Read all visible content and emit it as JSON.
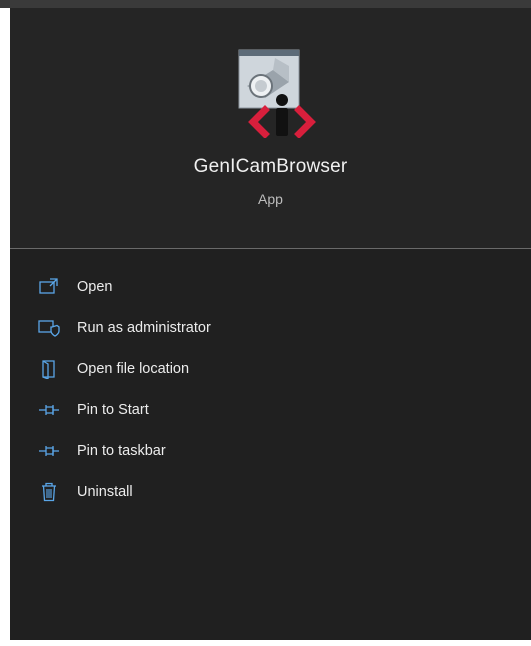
{
  "app": {
    "name": "GenICamBrowser",
    "kind": "App",
    "icon": "genicam-browser-icon"
  },
  "colors": {
    "panel_bg": "#202020",
    "header_bg": "#252525",
    "accent_icon": "#5aa6e8",
    "brand_red": "#d81f3c"
  },
  "menu": {
    "items": [
      {
        "label": "Open",
        "icon": "open-icon"
      },
      {
        "label": "Run as administrator",
        "icon": "run-as-admin-icon"
      },
      {
        "label": "Open file location",
        "icon": "open-file-location-icon"
      },
      {
        "label": "Pin to Start",
        "icon": "pin-icon"
      },
      {
        "label": "Pin to taskbar",
        "icon": "pin-icon"
      },
      {
        "label": "Uninstall",
        "icon": "trash-icon"
      }
    ]
  }
}
